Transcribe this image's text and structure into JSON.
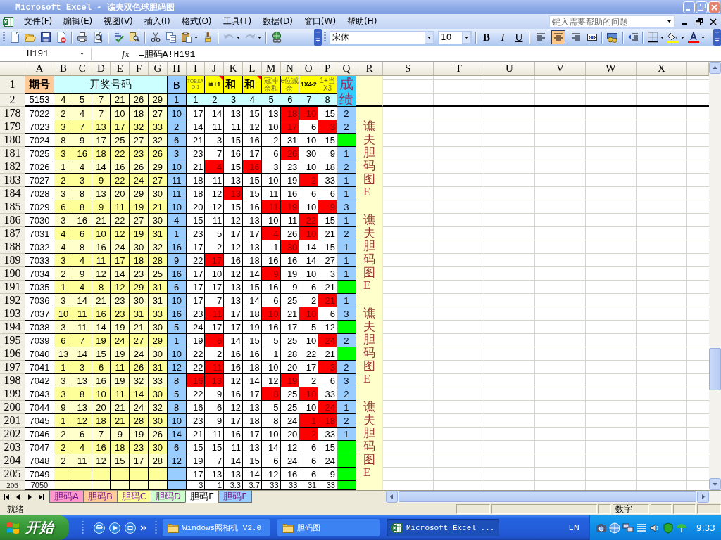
{
  "window": {
    "title": "Microsoft Excel - 谯夫双色球胆码图"
  },
  "menu_bar": {
    "items": [
      "文件(F)",
      "编辑(E)",
      "视图(V)",
      "插入(I)",
      "格式(O)",
      "工具(T)",
      "数据(D)",
      "窗口(W)",
      "帮助(H)"
    ],
    "help_box": {
      "placeholder": "键入需要帮助的问题"
    }
  },
  "toolbar": {
    "history_buttons": [
      {
        "disabled": true
      },
      {
        "disabled": true
      }
    ],
    "font_name": "宋体",
    "font_size": "10",
    "style_buttons": [
      "B",
      "I",
      "U"
    ],
    "align_buttons": [
      {
        "selected": false
      },
      {
        "selected": true
      },
      {
        "selected": false
      }
    ]
  },
  "formula_bar": {
    "name_box": "H191",
    "function_label": "fx",
    "formula": "=胆码A!H191"
  },
  "sheet": {
    "columns": [
      "A",
      "B",
      "C",
      "D",
      "E",
      "F",
      "G",
      "H",
      "I",
      "J",
      "K",
      "L",
      "M",
      "N",
      "O",
      "P",
      "Q",
      "R",
      "S",
      "T",
      "U",
      "V",
      "W",
      "X"
    ],
    "title_row": {
      "label": "1",
      "issue_header": "期号",
      "draw_header": "开奖号码",
      "b_header": "B",
      "pick_headers": [
        {
          "text": "TOB&AO 1",
          "kind": "tiny",
          "comment": false
        },
        {
          "text": "≌+1",
          "kind": "label",
          "comment": true
        },
        {
          "text": "和",
          "kind": "heading",
          "comment": false
        },
        {
          "text": "和",
          "kind": "heading",
          "comment": true
        },
        {
          "text": "冠冲余和",
          "kind": "note",
          "comment": false
        },
        {
          "text": "e位减余",
          "kind": "note",
          "comment": false
        },
        {
          "text": "1X4-2",
          "kind": "label",
          "comment": false
        },
        {
          "text": "1+当X3",
          "kind": "note",
          "comment": false
        }
      ],
      "grade_header": "成绩"
    },
    "index_row": {
      "label": "2",
      "issue": "5153",
      "draw": [
        "4",
        "5",
        "7",
        "21",
        "26",
        "29"
      ],
      "b": "1",
      "picks": [
        "1",
        "2",
        "3",
        "4",
        "5",
        "6",
        "7",
        "8"
      ]
    },
    "rows": [
      {
        "label": "178",
        "issue": "7022",
        "draw": [
          "2",
          "4",
          "7",
          "10",
          "18",
          "27"
        ],
        "b": "10",
        "picks": [
          {
            "text": "17",
            "highlighted": false
          },
          {
            "text": "14",
            "highlighted": false
          },
          {
            "text": "13",
            "highlighted": false
          },
          {
            "text": "15",
            "highlighted": false
          },
          {
            "text": "13",
            "highlighted": false
          },
          {
            "text": "18",
            "highlighted": true
          },
          {
            "text": "10",
            "highlighted": true
          },
          {
            "text": "15",
            "highlighted": false
          }
        ],
        "grade": {
          "text": "2",
          "highlighted": false
        }
      },
      {
        "label": "179",
        "issue": "7023",
        "draw": [
          "3",
          "7",
          "13",
          "17",
          "32",
          "33"
        ],
        "b": "2",
        "picks": [
          {
            "text": "14",
            "highlighted": false
          },
          {
            "text": "11",
            "highlighted": false
          },
          {
            "text": "11",
            "highlighted": false
          },
          {
            "text": "12",
            "highlighted": false
          },
          {
            "text": "10",
            "highlighted": false
          },
          {
            "text": "17",
            "highlighted": true
          },
          {
            "text": "6",
            "highlighted": false
          },
          {
            "text": "3",
            "highlighted": true
          }
        ],
        "grade": {
          "text": "2",
          "highlighted": false
        },
        "side_label": "谯夫胆码图E"
      },
      {
        "label": "180",
        "issue": "7024",
        "draw": [
          "8",
          "9",
          "17",
          "25",
          "27",
          "32"
        ],
        "b": "6",
        "picks": [
          {
            "text": "21",
            "highlighted": false
          },
          {
            "text": "3",
            "highlighted": false
          },
          {
            "text": "15",
            "highlighted": false
          },
          {
            "text": "16",
            "highlighted": false
          },
          {
            "text": "2",
            "highlighted": false
          },
          {
            "text": "31",
            "highlighted": false
          },
          {
            "text": "10",
            "highlighted": false
          },
          {
            "text": "15",
            "highlighted": false
          }
        ],
        "grade": {
          "highlighted": true
        }
      },
      {
        "label": "181",
        "issue": "7025",
        "draw": [
          "3",
          "16",
          "18",
          "22",
          "23",
          "26"
        ],
        "b": "3",
        "picks": [
          {
            "text": "23",
            "highlighted": false
          },
          {
            "text": "7",
            "highlighted": false
          },
          {
            "text": "16",
            "highlighted": false
          },
          {
            "text": "17",
            "highlighted": false
          },
          {
            "text": "6",
            "highlighted": false
          },
          {
            "text": "26",
            "highlighted": true
          },
          {
            "text": "30",
            "highlighted": false
          },
          {
            "text": "9",
            "highlighted": false
          }
        ],
        "grade": {
          "text": "1",
          "highlighted": false
        }
      },
      {
        "label": "182",
        "issue": "7026",
        "draw": [
          "1",
          "4",
          "14",
          "16",
          "26",
          "29"
        ],
        "b": "10",
        "picks": [
          {
            "text": "21",
            "highlighted": false
          },
          {
            "text": "4",
            "highlighted": true
          },
          {
            "text": "15",
            "highlighted": false
          },
          {
            "text": "16",
            "highlighted": true
          },
          {
            "text": "3",
            "highlighted": false
          },
          {
            "text": "23",
            "highlighted": false
          },
          {
            "text": "10",
            "highlighted": false
          },
          {
            "text": "18",
            "highlighted": false
          }
        ],
        "grade": {
          "text": "2",
          "highlighted": false
        }
      },
      {
        "label": "183",
        "issue": "7027",
        "draw": [
          "2",
          "3",
          "9",
          "22",
          "24",
          "27"
        ],
        "b": "11",
        "picks": [
          {
            "text": "18",
            "highlighted": false
          },
          {
            "text": "11",
            "highlighted": false
          },
          {
            "text": "13",
            "highlighted": false
          },
          {
            "text": "15",
            "highlighted": false
          },
          {
            "text": "10",
            "highlighted": false
          },
          {
            "text": "19",
            "highlighted": false
          },
          {
            "text": "2",
            "highlighted": true
          },
          {
            "text": "33",
            "highlighted": false
          }
        ],
        "grade": {
          "text": "1",
          "highlighted": false
        }
      },
      {
        "label": "184",
        "issue": "7028",
        "draw": [
          "3",
          "8",
          "13",
          "20",
          "29",
          "30"
        ],
        "b": "11",
        "picks": [
          {
            "text": "18",
            "highlighted": false
          },
          {
            "text": "12",
            "highlighted": false
          },
          {
            "text": "13",
            "highlighted": true
          },
          {
            "text": "15",
            "highlighted": false
          },
          {
            "text": "11",
            "highlighted": false
          },
          {
            "text": "16",
            "highlighted": false
          },
          {
            "text": "6",
            "highlighted": false
          },
          {
            "text": "6",
            "highlighted": false
          }
        ],
        "grade": {
          "text": "1",
          "highlighted": false
        }
      },
      {
        "label": "185",
        "issue": "7029",
        "draw": [
          "6",
          "8",
          "9",
          "11",
          "19",
          "21"
        ],
        "b": "10",
        "picks": [
          {
            "text": "20",
            "highlighted": false
          },
          {
            "text": "12",
            "highlighted": false
          },
          {
            "text": "15",
            "highlighted": false
          },
          {
            "text": "16",
            "highlighted": false
          },
          {
            "text": "11",
            "highlighted": true
          },
          {
            "text": "19",
            "highlighted": true
          },
          {
            "text": "10",
            "highlighted": false
          },
          {
            "text": "9",
            "highlighted": true
          }
        ],
        "grade": {
          "text": "3",
          "highlighted": false
        }
      },
      {
        "label": "186",
        "issue": "7030",
        "draw": [
          "3",
          "16",
          "21",
          "22",
          "27",
          "30"
        ],
        "b": "4",
        "picks": [
          {
            "text": "15",
            "highlighted": false
          },
          {
            "text": "11",
            "highlighted": false
          },
          {
            "text": "12",
            "highlighted": false
          },
          {
            "text": "13",
            "highlighted": false
          },
          {
            "text": "10",
            "highlighted": false
          },
          {
            "text": "11",
            "highlighted": false
          },
          {
            "text": "22",
            "highlighted": true
          },
          {
            "text": "15",
            "highlighted": false
          }
        ],
        "grade": {
          "text": "1",
          "highlighted": false
        },
        "side_label": "谯夫胆码图E"
      },
      {
        "label": "187",
        "issue": "7031",
        "draw": [
          "4",
          "6",
          "10",
          "12",
          "19",
          "31"
        ],
        "b": "1",
        "picks": [
          {
            "text": "23",
            "highlighted": false
          },
          {
            "text": "5",
            "highlighted": false
          },
          {
            "text": "17",
            "highlighted": false
          },
          {
            "text": "17",
            "highlighted": false
          },
          {
            "text": "4",
            "highlighted": true
          },
          {
            "text": "26",
            "highlighted": false
          },
          {
            "text": "10",
            "highlighted": true
          },
          {
            "text": "21",
            "highlighted": false
          }
        ],
        "grade": {
          "text": "2",
          "highlighted": false
        }
      },
      {
        "label": "188",
        "issue": "7032",
        "draw": [
          "4",
          "8",
          "16",
          "24",
          "30",
          "32"
        ],
        "b": "16",
        "picks": [
          {
            "text": "17",
            "highlighted": false
          },
          {
            "text": "2",
            "highlighted": false
          },
          {
            "text": "12",
            "highlighted": false
          },
          {
            "text": "13",
            "highlighted": false
          },
          {
            "text": "1",
            "highlighted": false
          },
          {
            "text": "30",
            "highlighted": true
          },
          {
            "text": "14",
            "highlighted": false
          },
          {
            "text": "15",
            "highlighted": false
          }
        ],
        "grade": {
          "text": "1",
          "highlighted": false
        }
      },
      {
        "label": "189",
        "issue": "7033",
        "draw": [
          "3",
          "4",
          "11",
          "17",
          "18",
          "28"
        ],
        "b": "9",
        "picks": [
          {
            "text": "22",
            "highlighted": false
          },
          {
            "text": "17",
            "highlighted": true
          },
          {
            "text": "16",
            "highlighted": false
          },
          {
            "text": "18",
            "highlighted": false
          },
          {
            "text": "16",
            "highlighted": false
          },
          {
            "text": "16",
            "highlighted": false
          },
          {
            "text": "14",
            "highlighted": false
          },
          {
            "text": "27",
            "highlighted": false
          }
        ],
        "grade": {
          "text": "1",
          "highlighted": false
        }
      },
      {
        "label": "190",
        "issue": "7034",
        "draw": [
          "2",
          "9",
          "12",
          "14",
          "23",
          "25"
        ],
        "b": "16",
        "picks": [
          {
            "text": "17",
            "highlighted": false
          },
          {
            "text": "10",
            "highlighted": false
          },
          {
            "text": "12",
            "highlighted": false
          },
          {
            "text": "14",
            "highlighted": false
          },
          {
            "text": "9",
            "highlighted": true
          },
          {
            "text": "19",
            "highlighted": false
          },
          {
            "text": "10",
            "highlighted": false
          },
          {
            "text": "3",
            "highlighted": false
          }
        ],
        "grade": {
          "text": "1",
          "highlighted": false
        }
      },
      {
        "label": "191",
        "issue": "7035",
        "draw": [
          "1",
          "4",
          "8",
          "12",
          "29",
          "31"
        ],
        "b": "6",
        "picks": [
          {
            "text": "17",
            "highlighted": false
          },
          {
            "text": "17",
            "highlighted": false
          },
          {
            "text": "13",
            "highlighted": false
          },
          {
            "text": "15",
            "highlighted": false
          },
          {
            "text": "16",
            "highlighted": false
          },
          {
            "text": "9",
            "highlighted": false
          },
          {
            "text": "6",
            "highlighted": false
          },
          {
            "text": "21",
            "highlighted": false
          }
        ],
        "grade": {
          "highlighted": true
        }
      },
      {
        "label": "192",
        "issue": "7036",
        "draw": [
          "3",
          "14",
          "21",
          "23",
          "30",
          "31"
        ],
        "b": "10",
        "picks": [
          {
            "text": "17",
            "highlighted": false
          },
          {
            "text": "7",
            "highlighted": false
          },
          {
            "text": "13",
            "highlighted": false
          },
          {
            "text": "14",
            "highlighted": false
          },
          {
            "text": "6",
            "highlighted": false
          },
          {
            "text": "25",
            "highlighted": false
          },
          {
            "text": "2",
            "highlighted": false
          },
          {
            "text": "21",
            "highlighted": true
          }
        ],
        "grade": {
          "text": "1",
          "highlighted": false
        }
      },
      {
        "label": "193",
        "issue": "7037",
        "draw": [
          "10",
          "11",
          "16",
          "23",
          "31",
          "33"
        ],
        "b": "16",
        "picks": [
          {
            "text": "23",
            "highlighted": false
          },
          {
            "text": "11",
            "highlighted": true
          },
          {
            "text": "17",
            "highlighted": false
          },
          {
            "text": "18",
            "highlighted": false
          },
          {
            "text": "10",
            "highlighted": true
          },
          {
            "text": "21",
            "highlighted": false
          },
          {
            "text": "10",
            "highlighted": true
          },
          {
            "text": "6",
            "highlighted": false
          }
        ],
        "grade": {
          "text": "3",
          "highlighted": false
        },
        "side_label": "谯夫胆码图E"
      },
      {
        "label": "194",
        "issue": "7038",
        "draw": [
          "3",
          "11",
          "14",
          "19",
          "21",
          "30"
        ],
        "b": "5",
        "picks": [
          {
            "text": "24",
            "highlighted": false
          },
          {
            "text": "17",
            "highlighted": false
          },
          {
            "text": "17",
            "highlighted": false
          },
          {
            "text": "19",
            "highlighted": false
          },
          {
            "text": "16",
            "highlighted": false
          },
          {
            "text": "17",
            "highlighted": false
          },
          {
            "text": "5",
            "highlighted": false
          },
          {
            "text": "12",
            "highlighted": false
          }
        ],
        "grade": {
          "highlighted": true
        }
      },
      {
        "label": "195",
        "issue": "7039",
        "draw": [
          "6",
          "7",
          "19",
          "24",
          "27",
          "29"
        ],
        "b": "1",
        "picks": [
          {
            "text": "19",
            "highlighted": false
          },
          {
            "text": "6",
            "highlighted": true
          },
          {
            "text": "14",
            "highlighted": false
          },
          {
            "text": "15",
            "highlighted": false
          },
          {
            "text": "5",
            "highlighted": false
          },
          {
            "text": "25",
            "highlighted": false
          },
          {
            "text": "10",
            "highlighted": false
          },
          {
            "text": "24",
            "highlighted": true
          }
        ],
        "grade": {
          "text": "2",
          "highlighted": false
        }
      },
      {
        "label": "196",
        "issue": "7040",
        "draw": [
          "13",
          "14",
          "15",
          "19",
          "24",
          "30"
        ],
        "b": "10",
        "picks": [
          {
            "text": "22",
            "highlighted": false
          },
          {
            "text": "2",
            "highlighted": false
          },
          {
            "text": "16",
            "highlighted": false
          },
          {
            "text": "16",
            "highlighted": false
          },
          {
            "text": "1",
            "highlighted": false
          },
          {
            "text": "28",
            "highlighted": false
          },
          {
            "text": "22",
            "highlighted": false
          },
          {
            "text": "21",
            "highlighted": false
          }
        ],
        "grade": {
          "highlighted": true
        }
      },
      {
        "label": "197",
        "issue": "7041",
        "draw": [
          "1",
          "3",
          "6",
          "11",
          "26",
          "31"
        ],
        "b": "12",
        "picks": [
          {
            "text": "22",
            "highlighted": false
          },
          {
            "text": "11",
            "highlighted": true
          },
          {
            "text": "16",
            "highlighted": false
          },
          {
            "text": "18",
            "highlighted": false
          },
          {
            "text": "10",
            "highlighted": false
          },
          {
            "text": "20",
            "highlighted": false
          },
          {
            "text": "17",
            "highlighted": false
          },
          {
            "text": "3",
            "highlighted": true
          }
        ],
        "grade": {
          "text": "2",
          "highlighted": false
        }
      },
      {
        "label": "198",
        "issue": "7042",
        "draw": [
          "3",
          "13",
          "16",
          "19",
          "32",
          "33"
        ],
        "b": "8",
        "picks": [
          {
            "text": "16",
            "highlighted": true
          },
          {
            "text": "13",
            "highlighted": true
          },
          {
            "text": "12",
            "highlighted": false
          },
          {
            "text": "14",
            "highlighted": false
          },
          {
            "text": "12",
            "highlighted": false
          },
          {
            "text": "19",
            "highlighted": true
          },
          {
            "text": "2",
            "highlighted": false
          },
          {
            "text": "6",
            "highlighted": false
          }
        ],
        "grade": {
          "text": "3",
          "highlighted": false
        }
      },
      {
        "label": "199",
        "issue": "7043",
        "draw": [
          "3",
          "8",
          "10",
          "11",
          "14",
          "30"
        ],
        "b": "5",
        "picks": [
          {
            "text": "22",
            "highlighted": false
          },
          {
            "text": "9",
            "highlighted": false
          },
          {
            "text": "16",
            "highlighted": false
          },
          {
            "text": "17",
            "highlighted": false
          },
          {
            "text": "8",
            "highlighted": true
          },
          {
            "text": "25",
            "highlighted": false
          },
          {
            "text": "10",
            "highlighted": true
          },
          {
            "text": "33",
            "highlighted": false
          }
        ],
        "grade": {
          "text": "2",
          "highlighted": false
        }
      },
      {
        "label": "200",
        "issue": "7044",
        "draw": [
          "9",
          "13",
          "20",
          "21",
          "24",
          "32"
        ],
        "b": "8",
        "picks": [
          {
            "text": "16",
            "highlighted": false
          },
          {
            "text": "6",
            "highlighted": false
          },
          {
            "text": "12",
            "highlighted": false
          },
          {
            "text": "13",
            "highlighted": false
          },
          {
            "text": "5",
            "highlighted": false
          },
          {
            "text": "25",
            "highlighted": false
          },
          {
            "text": "10",
            "highlighted": false
          },
          {
            "text": "24",
            "highlighted": true
          }
        ],
        "grade": {
          "text": "1",
          "highlighted": false
        },
        "side_label": "谯夫胆码图E"
      },
      {
        "label": "201",
        "issue": "7045",
        "draw": [
          "1",
          "12",
          "18",
          "21",
          "28",
          "30"
        ],
        "b": "10",
        "picks": [
          {
            "text": "23",
            "highlighted": false
          },
          {
            "text": "9",
            "highlighted": false
          },
          {
            "text": "17",
            "highlighted": false
          },
          {
            "text": "18",
            "highlighted": false
          },
          {
            "text": "8",
            "highlighted": false
          },
          {
            "text": "24",
            "highlighted": false
          },
          {
            "text": "1",
            "highlighted": true
          },
          {
            "text": "18",
            "highlighted": true
          }
        ],
        "grade": {
          "text": "2",
          "highlighted": false
        }
      },
      {
        "label": "202",
        "issue": "7046",
        "draw": [
          "2",
          "6",
          "7",
          "9",
          "19",
          "26"
        ],
        "b": "14",
        "picks": [
          {
            "text": "21",
            "highlighted": false
          },
          {
            "text": "11",
            "highlighted": false
          },
          {
            "text": "16",
            "highlighted": false
          },
          {
            "text": "17",
            "highlighted": false
          },
          {
            "text": "10",
            "highlighted": false
          },
          {
            "text": "20",
            "highlighted": false
          },
          {
            "text": "2",
            "highlighted": true
          },
          {
            "text": "33",
            "highlighted": false
          }
        ],
        "grade": {
          "text": "1",
          "highlighted": false
        }
      },
      {
        "label": "203",
        "issue": "7047",
        "draw": [
          "2",
          "4",
          "16",
          "18",
          "23",
          "30"
        ],
        "b": "6",
        "picks": [
          {
            "text": "15",
            "highlighted": false
          },
          {
            "text": "15",
            "highlighted": false
          },
          {
            "text": "11",
            "highlighted": false
          },
          {
            "text": "13",
            "highlighted": false
          },
          {
            "text": "14",
            "highlighted": false
          },
          {
            "text": "12",
            "highlighted": false
          },
          {
            "text": "6",
            "highlighted": false
          },
          {
            "text": "15",
            "highlighted": false
          }
        ],
        "grade": {
          "highlighted": true
        }
      },
      {
        "label": "204",
        "issue": "7048",
        "draw": [
          "2",
          "11",
          "12",
          "15",
          "17",
          "28"
        ],
        "b": "12",
        "picks": [
          {
            "text": "19",
            "highlighted": false
          },
          {
            "text": "7",
            "highlighted": false
          },
          {
            "text": "14",
            "highlighted": false
          },
          {
            "text": "15",
            "highlighted": false
          },
          {
            "text": "6",
            "highlighted": false
          },
          {
            "text": "24",
            "highlighted": false
          },
          {
            "text": "6",
            "highlighted": false
          },
          {
            "text": "24",
            "highlighted": false
          }
        ],
        "grade": {
          "highlighted": true
        }
      },
      {
        "label": "205",
        "issue": "7049",
        "picks": [
          {
            "text": "17",
            "highlighted": false
          },
          {
            "text": "13",
            "highlighted": false
          },
          {
            "text": "13",
            "highlighted": false
          },
          {
            "text": "14",
            "highlighted": false
          },
          {
            "text": "12",
            "highlighted": false
          },
          {
            "text": "16",
            "highlighted": false
          },
          {
            "text": "6",
            "highlighted": false
          },
          {
            "text": "9",
            "highlighted": false
          }
        ],
        "grade": {
          "highlighted": true
        }
      },
      {
        "label": "206",
        "issue": "7050",
        "picks": [
          {
            "text": "3",
            "highlighted": false
          },
          {
            "text": "1",
            "highlighted": false
          },
          {
            "text": "3.3",
            "highlighted": false
          },
          {
            "text": "3.7",
            "highlighted": false
          },
          {
            "text": "33",
            "highlighted": false
          },
          {
            "text": "33",
            "highlighted": false
          },
          {
            "text": "31",
            "highlighted": false
          },
          {
            "text": "33",
            "highlighted": false
          }
        ],
        "grade": {
          "highlighted": true
        }
      }
    ]
  },
  "sheet_tabs": [
    {
      "label": "胆码A",
      "color": "#ff99cc",
      "selected": false
    },
    {
      "label": "胆码B",
      "color": "#ffcc99",
      "selected": false
    },
    {
      "label": "胆码C",
      "color": "#ffff99",
      "selected": false
    },
    {
      "label": "胆码D",
      "color": "#ccffcc",
      "selected": false
    },
    {
      "label": "胆码E",
      "selected": true
    },
    {
      "label": "胆码F",
      "color": "#99ccff",
      "selected": false
    }
  ],
  "status_bar": {
    "status": "就绪",
    "indicator": "数字"
  },
  "taskbar": {
    "start_label": "开始",
    "tasks": [
      {
        "label": "Windows照相机 V2.0",
        "kind": "folder",
        "selected": false
      },
      {
        "label": "胆码图",
        "kind": "folder",
        "selected": false
      },
      {
        "label": "Microsoft Excel ...",
        "kind": "spreadsheet",
        "selected": true
      }
    ],
    "language": "EN",
    "clock": "9:33"
  }
}
